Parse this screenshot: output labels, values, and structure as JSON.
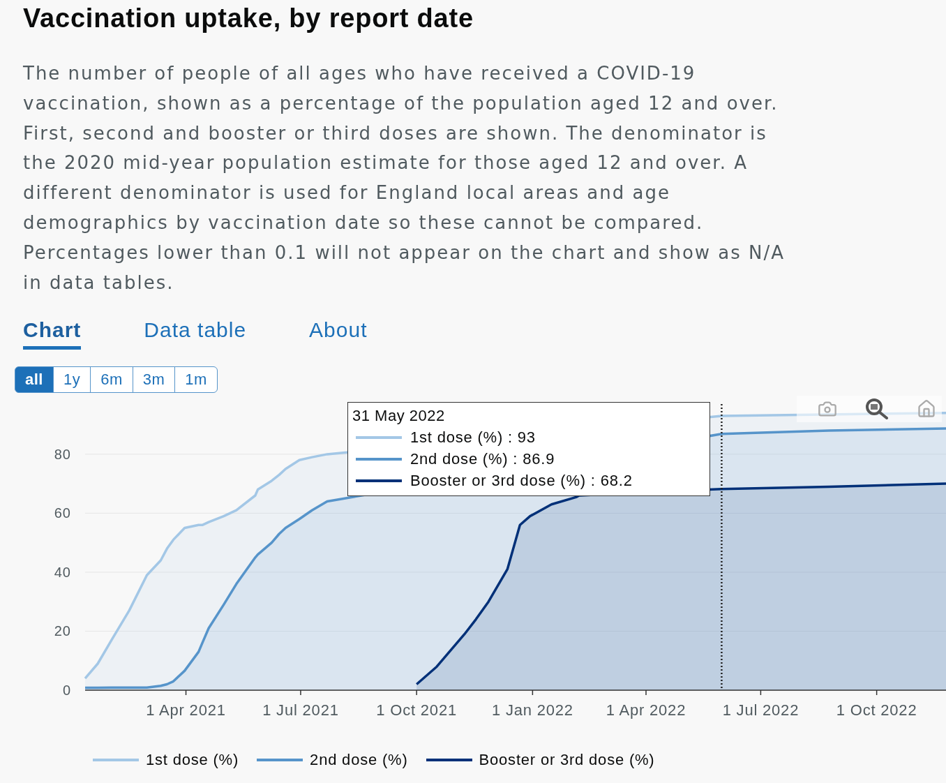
{
  "title": "Vaccination uptake, by report date",
  "description": "The number of people of all ages who have received a COVID-19 vaccination, shown as a percentage of the population aged 12 and over. First, second and booster or third doses are shown. The denominator is the 2020 mid-year population estimate for those aged 12 and over. A different denominator is used for England local areas and age demographics by vaccination date so these cannot be compared. Percentages lower than 0.1 will not appear on the chart and show as N/A in data tables.",
  "tabs": [
    {
      "label": "Chart",
      "selected": true
    },
    {
      "label": "Data table",
      "selected": false
    },
    {
      "label": "About",
      "selected": false
    }
  ],
  "range_buttons": [
    {
      "label": "all",
      "selected": true
    },
    {
      "label": "1y",
      "selected": false
    },
    {
      "label": "6m",
      "selected": false
    },
    {
      "label": "3m",
      "selected": false
    },
    {
      "label": "1m",
      "selected": false
    }
  ],
  "chart": {
    "tooltip": {
      "date": "31 May 2022",
      "entries": [
        "1st dose (%) : 93",
        "2nd dose (%) : 86.9",
        "Booster or 3rd dose (%) : 68.2"
      ]
    },
    "chart_data": {
      "type": "area",
      "x": [
        "2021-01-11",
        "2021-01-21",
        "2021-02-01",
        "2021-02-15",
        "2021-03-01",
        "2021-03-12",
        "2021-03-17",
        "2021-03-22",
        "2021-03-31",
        "2021-04-11",
        "2021-04-14",
        "2021-04-19",
        "2021-05-01",
        "2021-05-11",
        "2021-05-26",
        "2021-05-28",
        "2021-06-08",
        "2021-06-14",
        "2021-06-19",
        "2021-06-30",
        "2021-07-10",
        "2021-07-22",
        "2021-08-08",
        "2021-09-18",
        "2021-10-01",
        "2021-10-17",
        "2021-11-08",
        "2021-11-17",
        "2021-11-27",
        "2021-12-12",
        "2021-12-22",
        "2021-12-30",
        "2022-01-16",
        "2022-02-05",
        "2022-02-07",
        "2022-04-06",
        "2022-05-31",
        "2022-08-24",
        "2022-11-25"
      ],
      "xlim": [
        "2021-01-11",
        "2022-11-25"
      ],
      "ylim": [
        0,
        97
      ],
      "grid": true,
      "ref_lines": [
        {
          "axis": "x",
          "value": "2022-05-31",
          "color": "#222222"
        }
      ],
      "xticks": [
        {
          "value": "2021-04-01",
          "label": "1 Apr 2021"
        },
        {
          "value": "2021-07-01",
          "label": "1 Jul 2021"
        },
        {
          "value": "2021-10-01",
          "label": "1 Oct 2021"
        },
        {
          "value": "2022-01-01",
          "label": "1 Jan 2022"
        },
        {
          "value": "2022-04-01",
          "label": "1 Apr 2022"
        },
        {
          "value": "2022-07-01",
          "label": "1 Jul 2022"
        },
        {
          "value": "2022-10-01",
          "label": "1 Oct 2022"
        }
      ],
      "yticks": [
        0,
        20,
        40,
        60,
        80
      ],
      "series": [
        {
          "name": "1st dose (%)",
          "color": "#a3c7e6",
          "values": [
            4,
            9,
            17,
            27,
            39,
            44,
            48,
            51,
            55,
            56,
            56,
            57,
            59,
            61,
            66,
            68,
            71,
            73,
            75,
            78,
            79,
            80,
            null,
            null,
            null,
            null,
            null,
            null,
            null,
            null,
            null,
            null,
            null,
            null,
            null,
            null,
            93,
            null,
            94
          ]
        },
        {
          "name": "2nd dose (%)",
          "color": "#5694ca",
          "values": [
            0.8,
            0.8,
            0.9,
            0.9,
            0.9,
            1.5,
            2,
            3,
            6.6,
            13,
            16,
            21,
            29,
            36,
            45,
            46,
            50,
            53,
            55,
            58,
            61,
            64,
            null,
            null,
            null,
            null,
            null,
            null,
            null,
            null,
            null,
            null,
            null,
            null,
            null,
            null,
            86.9,
            88,
            88.7
          ]
        },
        {
          "name": "Booster or 3rd dose (%)",
          "color": "#003078",
          "values": [
            null,
            null,
            null,
            null,
            null,
            null,
            null,
            null,
            null,
            null,
            null,
            null,
            null,
            null,
            null,
            null,
            null,
            null,
            null,
            null,
            null,
            null,
            null,
            null,
            2,
            8,
            19,
            24,
            30,
            41,
            56,
            59,
            63,
            65.5,
            66,
            null,
            68.2,
            69,
            70
          ]
        }
      ]
    }
  }
}
